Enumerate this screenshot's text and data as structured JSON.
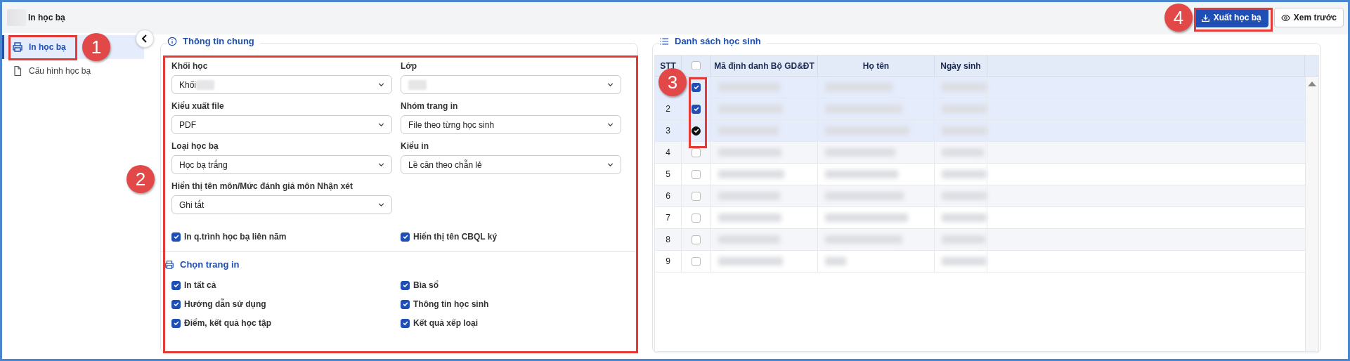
{
  "app": {
    "title": "In học bạ"
  },
  "actions": [
    {
      "label": "Xuất học bạ",
      "kind": "primary"
    },
    {
      "label": "Xem trước",
      "kind": "secondary"
    }
  ],
  "sidebar": {
    "items": [
      {
        "label": "In học bạ",
        "selected": true,
        "kind": "print"
      },
      {
        "label": "Cấu hình học bạ",
        "selected": false,
        "kind": "file"
      }
    ]
  },
  "general": {
    "title": "Thông tin chung",
    "fields": [
      {
        "label": "Khối học",
        "value": "Khối",
        "redacted": true
      },
      {
        "label": "Lớp",
        "redacted": true
      },
      {
        "label": "Kiểu xuất file",
        "value": "PDF"
      },
      {
        "label": "Nhóm trang in",
        "value": "File theo từng học sinh"
      },
      {
        "label": "Loại học bạ",
        "value": "Học bạ trắng"
      },
      {
        "label": "Kiểu in",
        "value": "Lề căn theo chẵn lẻ"
      },
      {
        "label": "Hiển thị tên môn/Mức đánh giá môn Nhận xét",
        "value": "Ghi tắt"
      }
    ],
    "options": [
      {
        "label": "In q.trình học bạ liên năm",
        "checked": true
      },
      {
        "label": "Hiển thị tên CBQL ký",
        "checked": true
      }
    ]
  },
  "pages": {
    "title": "Chọn trang in",
    "options": [
      {
        "label": "In tất cả",
        "checked": true
      },
      {
        "label": "Bìa sổ",
        "checked": true
      },
      {
        "label": "Hướng dẫn sử dụng",
        "checked": true
      },
      {
        "label": "Thông tin học sinh",
        "checked": true
      },
      {
        "label": "Điểm, kết quả học tập",
        "checked": true
      },
      {
        "label": "Kết quả xếp loại",
        "checked": true
      }
    ]
  },
  "students": {
    "title": "Danh sách học sinh",
    "columns": [
      "STT",
      "Mã định danh Bộ GD&ĐT",
      "Họ tên",
      "Ngày sinh"
    ],
    "select_all": false,
    "rows": [
      {
        "selected": true
      },
      {
        "stt": "2",
        "selected": true
      },
      {
        "stt": "3",
        "selected": true
      },
      {
        "stt": "4",
        "selected": false
      },
      {
        "stt": "5",
        "selected": false
      },
      {
        "stt": "6",
        "selected": false
      },
      {
        "stt": "7",
        "selected": false
      },
      {
        "stt": "8",
        "selected": false
      },
      {
        "stt": "9",
        "selected": false
      }
    ]
  },
  "annotations": [
    "1",
    "2",
    "3",
    "4"
  ]
}
